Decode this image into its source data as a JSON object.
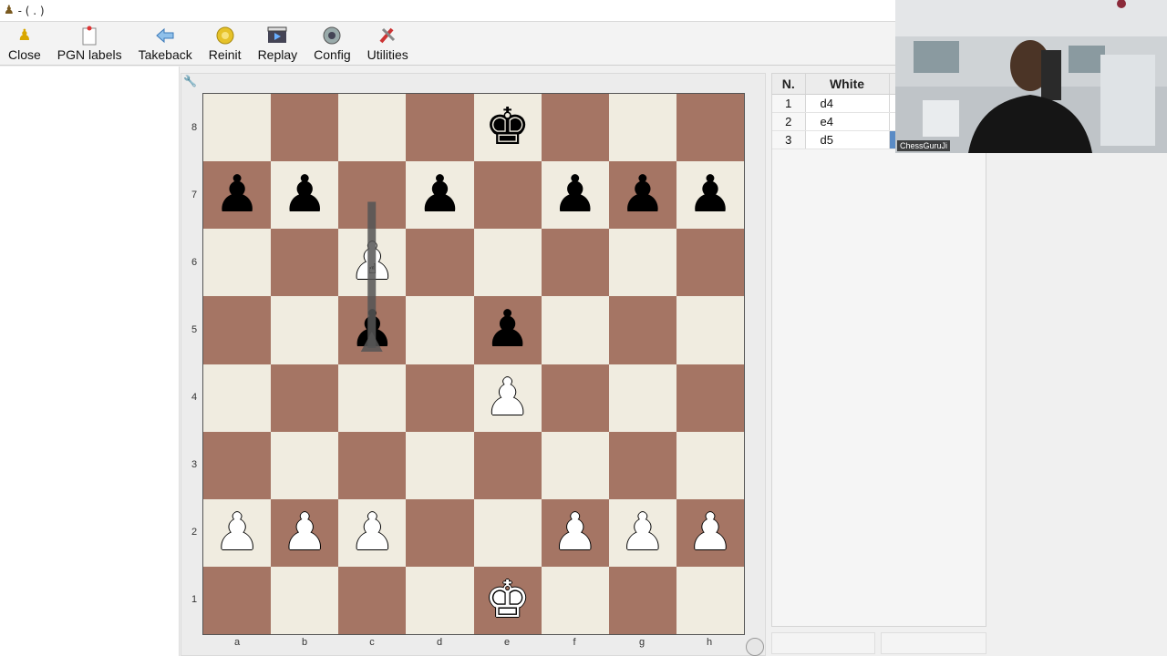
{
  "window": {
    "title": "- ( . )",
    "icon": "pawn-icon"
  },
  "toolbar": {
    "buttons": [
      {
        "id": "close",
        "label": "Close",
        "icon": "close-pawn-icon"
      },
      {
        "id": "pgn-labels",
        "label": "PGN labels",
        "icon": "label-icon"
      },
      {
        "id": "takeback",
        "label": "Takeback",
        "icon": "back-arrow-icon"
      },
      {
        "id": "reinit",
        "label": "Reinit",
        "icon": "reinit-icon"
      },
      {
        "id": "replay",
        "label": "Replay",
        "icon": "replay-icon"
      },
      {
        "id": "config",
        "label": "Config",
        "icon": "config-icon"
      },
      {
        "id": "utilities",
        "label": "Utilities",
        "icon": "utilities-icon"
      }
    ]
  },
  "board": {
    "ranks": [
      "8",
      "7",
      "6",
      "5",
      "4",
      "3",
      "2",
      "1"
    ],
    "files": [
      "a",
      "b",
      "c",
      "d",
      "e",
      "f",
      "g",
      "h"
    ],
    "light_color": "#f0ece0",
    "dark_color": "#a57564",
    "position": [
      [
        "",
        "",
        "",
        "",
        "bK",
        "",
        "",
        ""
      ],
      [
        "bP",
        "bP",
        "",
        "bP",
        "",
        "bP",
        "bP",
        "bP"
      ],
      [
        "",
        "",
        "wP",
        "",
        "",
        "",
        "",
        ""
      ],
      [
        "",
        "",
        "bP",
        "",
        "bP",
        "",
        "",
        ""
      ],
      [
        "",
        "",
        "",
        "",
        "wP",
        "",
        "",
        ""
      ],
      [
        "",
        "",
        "",
        "",
        "",
        "",
        "",
        ""
      ],
      [
        "wP",
        "wP",
        "wP",
        "",
        "",
        "wP",
        "wP",
        "wP"
      ],
      [
        "",
        "",
        "",
        "",
        "wK",
        "",
        "",
        ""
      ]
    ],
    "arrow": {
      "from": "c5",
      "to": "c7",
      "color": "#555555"
    }
  },
  "moves_panel": {
    "headers": {
      "number": "N.",
      "white": "White",
      "black": ""
    },
    "rows": [
      {
        "n": "1",
        "white": "d4",
        "black": ""
      },
      {
        "n": "2",
        "white": "e4",
        "black": ""
      },
      {
        "n": "3",
        "white": "d5",
        "black": ""
      }
    ],
    "selected_color": "#5a8bc5"
  },
  "webcam": {
    "name": "ChessGuruJi"
  }
}
